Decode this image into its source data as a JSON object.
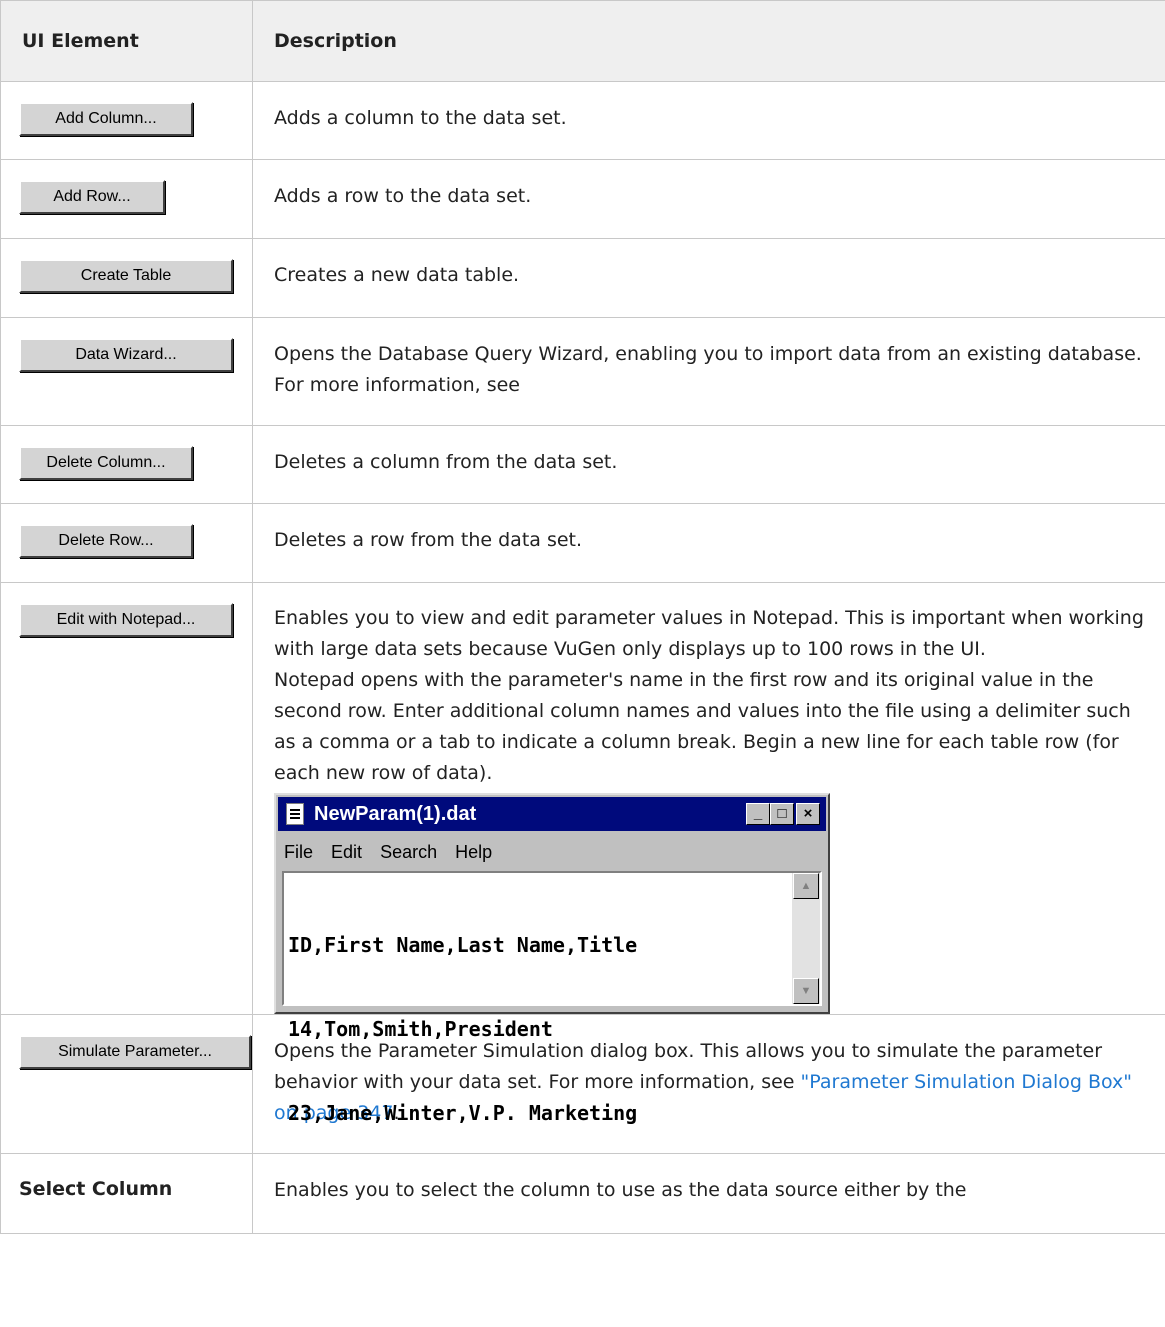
{
  "table": {
    "headers": {
      "element": "UI Element",
      "description": "Description"
    },
    "rows": [
      {
        "button": "Add Column...",
        "description": "Adds a column to the data set."
      },
      {
        "button": "Add Row...",
        "description": "Adds a row to the data set."
      },
      {
        "button": "Create Table",
        "description": "Creates a new data table."
      },
      {
        "button": "Data Wizard...",
        "description": "Opens the Database Query Wizard, enabling you to import data from an existing database. For more information, see"
      },
      {
        "button": "Delete Column...",
        "description": "Deletes a column from the data set."
      },
      {
        "button": "Delete Row...",
        "description": "Deletes a row from the data set."
      },
      {
        "button": "Edit with Notepad...",
        "description_1": "Enables you to view and edit parameter values in Notepad. This is important when working with large data sets because VuGen only displays up to 100 rows in the UI.",
        "description_2": "Notepad opens with the parameter's name in the first row and its original value in the second row. Enter additional column names and values into the file using a delimiter such as a comma or a tab to indicate a column break. Begin a new line for each table row (for each new row of data)."
      },
      {
        "button": "Simulate Parameter...",
        "description": "Opens the Parameter Simulation dialog box. This allows you to simulate the parameter behavior with your data set. For more information, see",
        "link": "\"Parameter Simulation Dialog Box\" on page 347",
        "after_link": "."
      },
      {
        "label": "Select Column",
        "description": "Enables you to select the column to use as the data source either by the"
      }
    ]
  },
  "notepad": {
    "title": "NewParam(1).dat",
    "window_buttons": {
      "minimize": "_",
      "maximize": "□",
      "close": "×"
    },
    "menu": [
      "File",
      "Edit",
      "Search",
      "Help"
    ],
    "lines": [
      "ID,First Name,Last Name,Title",
      "14,Tom,Smith,President",
      "23,Jane,Winter,V.P. Marketing"
    ]
  },
  "colors": {
    "link": "#1f78d1",
    "header_bg": "#efefef",
    "titlebar": "#000a7c"
  }
}
